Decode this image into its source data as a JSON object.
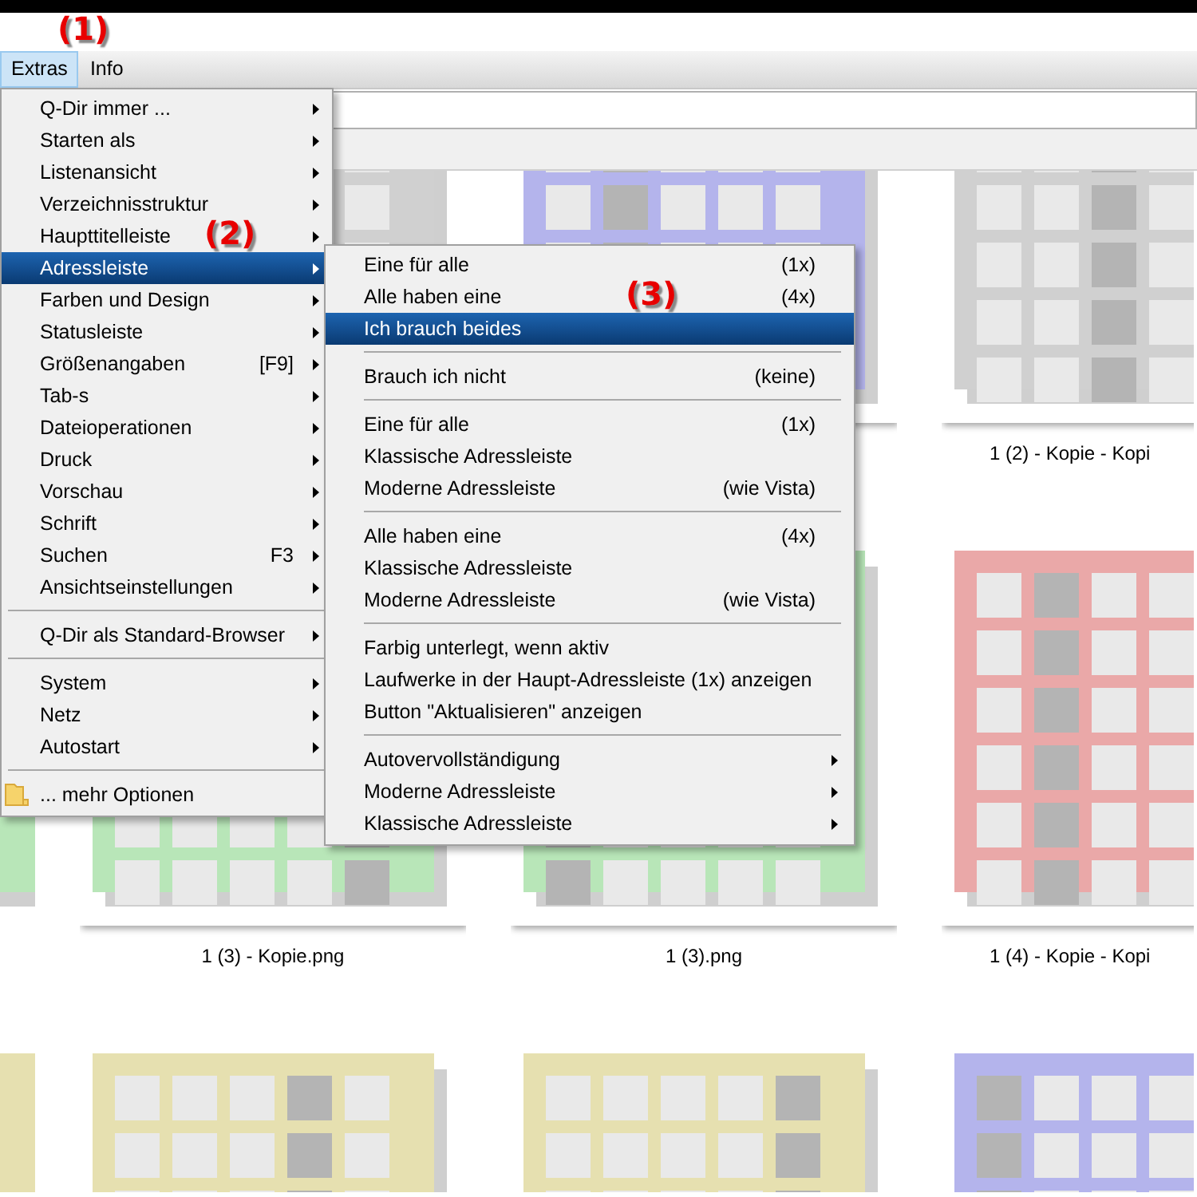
{
  "annotations": [
    {
      "text": "(1)"
    }
  ],
  "menubar": [
    {
      "label": "Extras",
      "selected": true
    },
    {
      "label": "Info",
      "selected": false
    }
  ],
  "extras_menu": [
    {
      "kind": "item",
      "label": "Q-Dir immer ...",
      "submenu": true,
      "selected": false
    },
    {
      "kind": "item",
      "label": "Starten als",
      "submenu": true,
      "selected": false
    },
    {
      "kind": "item",
      "label": "Listenansicht",
      "submenu": true,
      "selected": false
    },
    {
      "kind": "item",
      "label": "Verzeichnisstruktur",
      "submenu": true,
      "selected": false
    },
    {
      "kind": "item",
      "label": "Haupttitelleiste",
      "submenu": true,
      "selected": false,
      "annotation": "(2)"
    },
    {
      "kind": "item",
      "label": "Adressleiste",
      "submenu": true,
      "selected": true
    },
    {
      "kind": "item",
      "label": "Farben und Design",
      "submenu": true,
      "selected": false
    },
    {
      "kind": "item",
      "label": "Statusleiste",
      "submenu": true,
      "selected": false
    },
    {
      "kind": "item",
      "label": "Größenangaben",
      "shortcut": "[F9]",
      "submenu": true,
      "selected": false
    },
    {
      "kind": "item",
      "label": "Tab-s",
      "submenu": true,
      "selected": false
    },
    {
      "kind": "item",
      "label": "Dateioperationen",
      "submenu": true,
      "selected": false
    },
    {
      "kind": "item",
      "label": "Druck",
      "submenu": true,
      "selected": false
    },
    {
      "kind": "item",
      "label": "Vorschau",
      "submenu": true,
      "selected": false
    },
    {
      "kind": "item",
      "label": "Schrift",
      "submenu": true,
      "selected": false
    },
    {
      "kind": "item",
      "label": "Suchen",
      "shortcut": "F3",
      "submenu": true,
      "selected": false
    },
    {
      "kind": "item",
      "label": "Ansichtseinstellungen",
      "submenu": true,
      "selected": false
    },
    {
      "kind": "separator"
    },
    {
      "kind": "item",
      "label": "Q-Dir als Standard-Browser",
      "submenu": true,
      "selected": false
    },
    {
      "kind": "separator"
    },
    {
      "kind": "item",
      "label": "System",
      "submenu": true,
      "selected": false
    },
    {
      "kind": "item",
      "label": "Netz",
      "submenu": true,
      "selected": false
    },
    {
      "kind": "item",
      "label": "Autostart",
      "submenu": true,
      "selected": false
    },
    {
      "kind": "separator"
    },
    {
      "kind": "folder",
      "label": "... mehr Optionen",
      "submenu": false,
      "selected": false
    }
  ],
  "address_submenu": [
    {
      "kind": "item",
      "label": "Eine für alle",
      "shortcut": "(1x)",
      "submenu": false,
      "selected": false
    },
    {
      "kind": "item",
      "label": "Alle haben eine",
      "shortcut": "(4x)",
      "submenu": false,
      "selected": false,
      "annotation": "(3)"
    },
    {
      "kind": "item",
      "label": "Ich brauch beides",
      "submenu": false,
      "selected": true
    },
    {
      "kind": "separator"
    },
    {
      "kind": "item",
      "label": "Brauch ich nicht",
      "shortcut": "(keine)",
      "submenu": false,
      "selected": false
    },
    {
      "kind": "separator"
    },
    {
      "kind": "item",
      "label": "Eine für alle",
      "shortcut": "(1x)",
      "submenu": false,
      "selected": false
    },
    {
      "kind": "item",
      "label": "Klassische Adressleiste",
      "submenu": false,
      "selected": false
    },
    {
      "kind": "item",
      "label": "Moderne Adressleiste",
      "shortcut": "(wie Vista)",
      "submenu": false,
      "selected": false
    },
    {
      "kind": "separator"
    },
    {
      "kind": "item",
      "label": "Alle haben eine",
      "shortcut": "(4x)",
      "submenu": false,
      "selected": false
    },
    {
      "kind": "item",
      "label": "Klassische Adressleiste",
      "submenu": false,
      "selected": false
    },
    {
      "kind": "item",
      "label": "Moderne Adressleiste",
      "shortcut": "(wie Vista)",
      "submenu": false,
      "selected": false
    },
    {
      "kind": "separator"
    },
    {
      "kind": "item",
      "label": "Farbig unterlegt, wenn aktiv",
      "submenu": false,
      "selected": false
    },
    {
      "kind": "item",
      "label": "Laufwerke in der Haupt-Adressleiste (1x) anzeigen",
      "submenu": false,
      "selected": false
    },
    {
      "kind": "item",
      "label": "Button \"Aktualisieren\" anzeigen",
      "submenu": false,
      "selected": false
    },
    {
      "kind": "separator"
    },
    {
      "kind": "item",
      "label": "Autovervollständigung",
      "submenu": true,
      "selected": false
    },
    {
      "kind": "item",
      "label": "Moderne Adressleiste",
      "submenu": true,
      "selected": false
    },
    {
      "kind": "item",
      "label": "Klassische Adressleiste",
      "submenu": true,
      "selected": false
    }
  ],
  "thumbnails": [
    {
      "color": "#d0d0d0"
    },
    {
      "color": "#b4b4ec"
    },
    {
      "color": "#d0d0d0",
      "caption": "1 (2) - Kopie - Kopi"
    },
    {
      "color": "#b8e6b8"
    },
    {
      "color": "#b8e6b8",
      "caption": "1 (3) - Kopie.png"
    },
    {
      "color": "#b8e6b8",
      "caption": "1 (3).png"
    },
    {
      "color": "#eaa8a8",
      "caption": "1 (4) - Kopie - Kopi"
    },
    {
      "color": "#e6e0b0"
    },
    {
      "color": "#e6e0b0"
    },
    {
      "color": "#e6e0b0"
    },
    {
      "color": "#b4b4ec"
    }
  ]
}
